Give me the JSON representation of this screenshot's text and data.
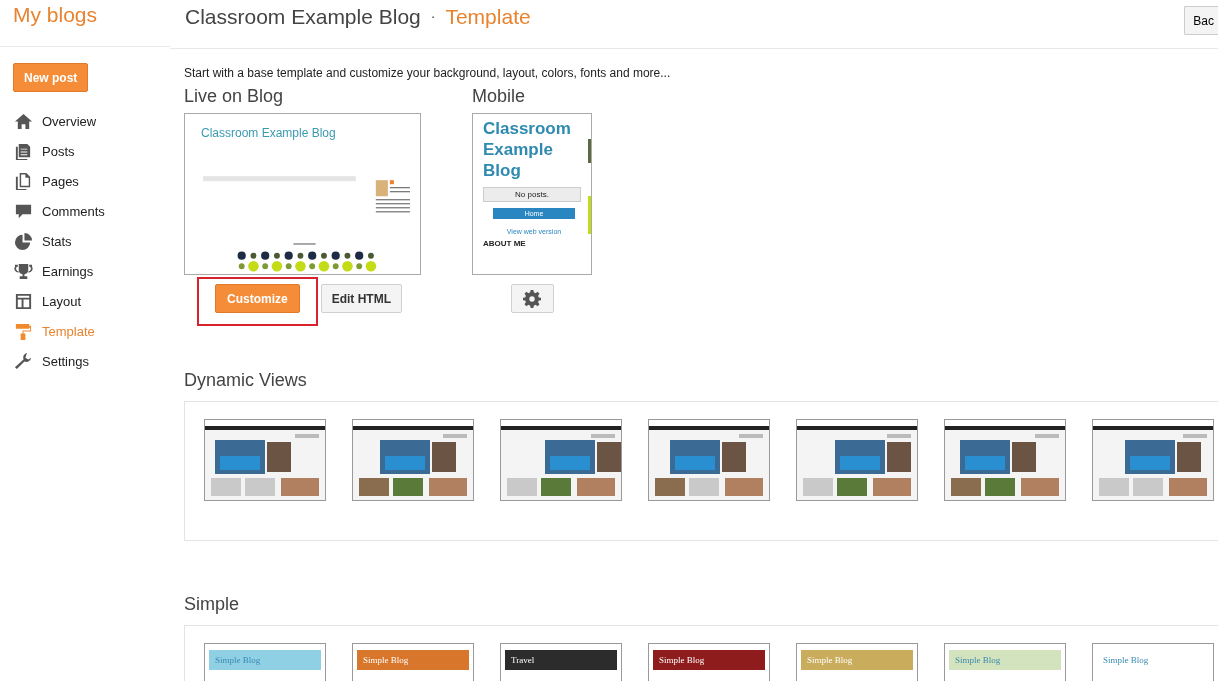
{
  "header": {
    "brand": "My blogs",
    "blog_title": "Classroom Example Blog",
    "separator": "·",
    "section": "Template",
    "back_button": "Bac"
  },
  "new_post": "New post",
  "sidebar": {
    "items": [
      {
        "label": "Overview",
        "selected": false
      },
      {
        "label": "Posts",
        "selected": false
      },
      {
        "label": "Pages",
        "selected": false
      },
      {
        "label": "Comments",
        "selected": false
      },
      {
        "label": "Stats",
        "selected": false
      },
      {
        "label": "Earnings",
        "selected": false
      },
      {
        "label": "Layout",
        "selected": false
      },
      {
        "label": "Template",
        "selected": true
      },
      {
        "label": "Settings",
        "selected": false
      }
    ]
  },
  "intro": "Start with a base template and customize your background, layout, colors, fonts and more...",
  "live": {
    "heading": "Live on Blog",
    "preview_title": "Classroom Example Blog",
    "customize": "Customize",
    "edit_html": "Edit HTML",
    "highlighted": true
  },
  "mobile": {
    "heading": "Mobile",
    "preview_title": "Classroom Example Blog",
    "no_posts": "No posts.",
    "home": "Home",
    "web_version": "View web version",
    "about": "ABOUT ME"
  },
  "dynamic_views": {
    "heading": "Dynamic Views"
  },
  "simple": {
    "heading": "Simple",
    "thumbnails": [
      {
        "title": "Simple Blog",
        "color": "#8fd0e4"
      },
      {
        "title": "Simple Blog",
        "color": "#d8772b"
      },
      {
        "title": "Travel",
        "color": "#2c2c2c"
      },
      {
        "title": "Simple Blog",
        "color": "#8e1c1c"
      },
      {
        "title": "Simple Blog",
        "color": "#c9ad5c"
      },
      {
        "title": "Simple Blog",
        "color": "#d3e3bd"
      },
      {
        "title": "Simple Blog",
        "color": "#ffffff"
      }
    ]
  }
}
